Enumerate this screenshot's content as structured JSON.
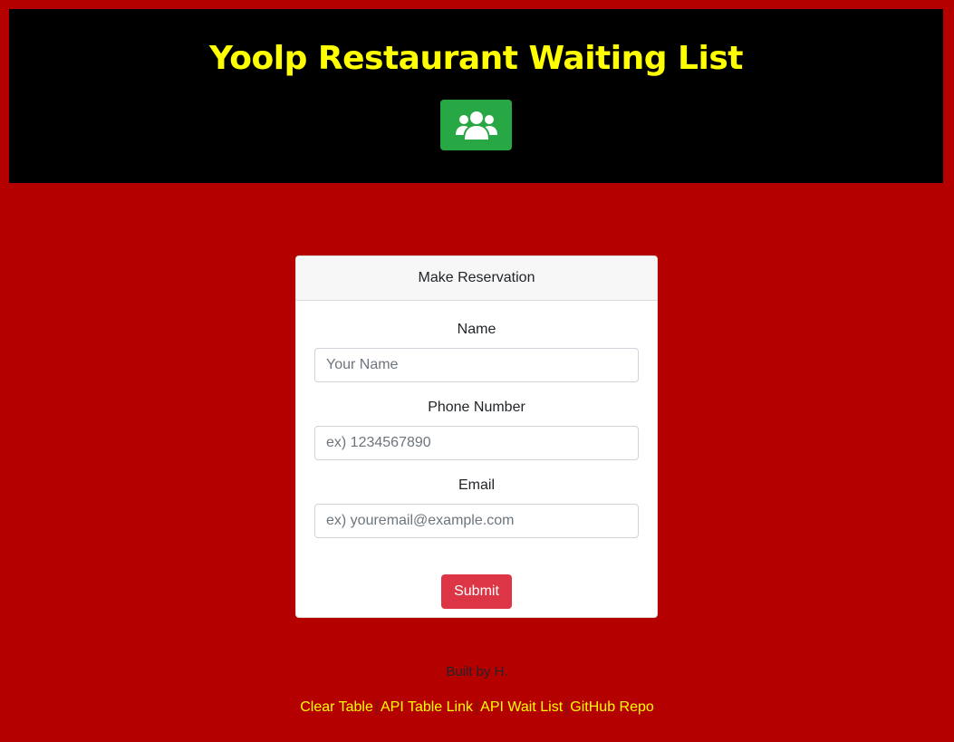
{
  "header": {
    "title": "Yoolp Restaurant Waiting List",
    "action_icon": "users-icon"
  },
  "form": {
    "card_title": "Make Reservation",
    "name_label": "Name",
    "name_placeholder": "Your Name",
    "name_value": "",
    "phone_label": "Phone Number",
    "phone_placeholder": "ex) 1234567890",
    "phone_value": "",
    "email_label": "Email",
    "email_placeholder": "ex) youremail@example.com",
    "email_value": "",
    "submit_label": "Submit"
  },
  "footer": {
    "credit": "Built by H.",
    "links": [
      {
        "label": "Clear Table"
      },
      {
        "label": "API Table Link"
      },
      {
        "label": "API Wait List"
      },
      {
        "label": "GitHub Repo"
      }
    ],
    "separator": "|"
  },
  "colors": {
    "page_background": "#b50000",
    "header_background": "#000000",
    "title": "#ffff00",
    "header_button": "#28a745",
    "submit_button": "#dc3545",
    "link": "#ffff00"
  }
}
